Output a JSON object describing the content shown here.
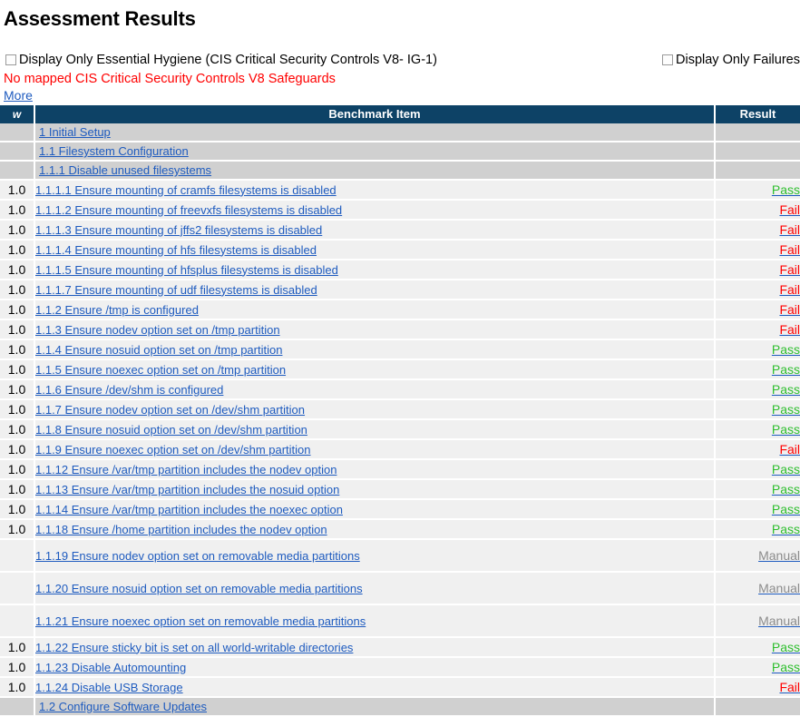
{
  "page_title": "Assessment Results",
  "filters": {
    "essential_hygiene_label": "Display Only Essential Hygiene (CIS Critical Security Controls V8- IG-1)",
    "essential_hygiene_checked": false,
    "only_failures_label": "Display Only Failures",
    "only_failures_checked": false
  },
  "notice": {
    "text": "No mapped CIS Critical Security Controls V8 Safeguards",
    "color": "#ff0000",
    "more_label": "More"
  },
  "table": {
    "headers": {
      "weight": "w",
      "benchmark_item": "Benchmark Item",
      "result": "Result"
    },
    "colors": {
      "header_bg": "#0d4266",
      "section_bg": "#d0d0d0",
      "row_bg": "#f0f0f0",
      "link": "#1e5bbf",
      "pass": "#2fbf2f",
      "fail": "#ff0000",
      "manual": "#8c8c8c"
    },
    "rows": [
      {
        "kind": "section",
        "label": "1 Initial Setup"
      },
      {
        "kind": "section",
        "label": "1.1 Filesystem Configuration"
      },
      {
        "kind": "section",
        "label": "1.1.1 Disable unused filesystems"
      },
      {
        "kind": "item",
        "weight": "1.0",
        "label": "1.1.1.1 Ensure mounting of cramfs filesystems is disabled",
        "result": "Pass"
      },
      {
        "kind": "item",
        "weight": "1.0",
        "label": "1.1.1.2 Ensure mounting of freevxfs filesystems is disabled",
        "result": "Fail"
      },
      {
        "kind": "item",
        "weight": "1.0",
        "label": "1.1.1.3 Ensure mounting of jffs2 filesystems is disabled",
        "result": "Fail"
      },
      {
        "kind": "item",
        "weight": "1.0",
        "label": "1.1.1.4 Ensure mounting of hfs filesystems is disabled",
        "result": "Fail"
      },
      {
        "kind": "item",
        "weight": "1.0",
        "label": "1.1.1.5 Ensure mounting of hfsplus filesystems is disabled",
        "result": "Fail"
      },
      {
        "kind": "item",
        "weight": "1.0",
        "label": "1.1.1.7 Ensure mounting of udf filesystems is disabled",
        "result": "Fail"
      },
      {
        "kind": "item",
        "weight": "1.0",
        "label": "1.1.2 Ensure /tmp is configured",
        "result": "Fail"
      },
      {
        "kind": "item",
        "weight": "1.0",
        "label": "1.1.3 Ensure nodev option set on /tmp partition",
        "result": "Fail"
      },
      {
        "kind": "item",
        "weight": "1.0",
        "label": "1.1.4 Ensure nosuid option set on /tmp partition",
        "result": "Pass"
      },
      {
        "kind": "item",
        "weight": "1.0",
        "label": "1.1.5 Ensure noexec option set on /tmp partition",
        "result": "Pass"
      },
      {
        "kind": "item",
        "weight": "1.0",
        "label": "1.1.6 Ensure /dev/shm is configured",
        "result": "Pass"
      },
      {
        "kind": "item",
        "weight": "1.0",
        "label": "1.1.7 Ensure nodev option set on /dev/shm partition",
        "result": "Pass"
      },
      {
        "kind": "item",
        "weight": "1.0",
        "label": "1.1.8 Ensure nosuid option set on /dev/shm partition",
        "result": "Pass"
      },
      {
        "kind": "item",
        "weight": "1.0",
        "label": "1.1.9 Ensure noexec option set on /dev/shm partition",
        "result": "Fail"
      },
      {
        "kind": "item",
        "weight": "1.0",
        "label": "1.1.12 Ensure /var/tmp partition includes the nodev option",
        "result": "Pass"
      },
      {
        "kind": "item",
        "weight": "1.0",
        "label": "1.1.13 Ensure /var/tmp partition includes the nosuid option",
        "result": "Pass"
      },
      {
        "kind": "item",
        "weight": "1.0",
        "label": "1.1.14 Ensure /var/tmp partition includes the noexec option",
        "result": "Pass"
      },
      {
        "kind": "item",
        "weight": "1.0",
        "label": "1.1.18 Ensure /home partition includes the nodev option",
        "result": "Pass"
      },
      {
        "kind": "item",
        "tall": true,
        "weight": "",
        "label": "1.1.19 Ensure nodev option set on removable media partitions",
        "result": "Manual"
      },
      {
        "kind": "item",
        "tall": true,
        "weight": "",
        "label": "1.1.20 Ensure nosuid option set on removable media partitions",
        "result": "Manual"
      },
      {
        "kind": "item",
        "tall": true,
        "weight": "",
        "label": "1.1.21 Ensure noexec option set on removable media partitions",
        "result": "Manual"
      },
      {
        "kind": "item",
        "weight": "1.0",
        "label": "1.1.22 Ensure sticky bit is set on all world-writable directories",
        "result": "Pass"
      },
      {
        "kind": "item",
        "weight": "1.0",
        "label": "1.1.23 Disable Automounting",
        "result": "Pass"
      },
      {
        "kind": "item",
        "weight": "1.0",
        "label": "1.1.24 Disable USB Storage",
        "result": "Fail"
      },
      {
        "kind": "section",
        "label": "1.2 Configure Software Updates"
      }
    ]
  }
}
